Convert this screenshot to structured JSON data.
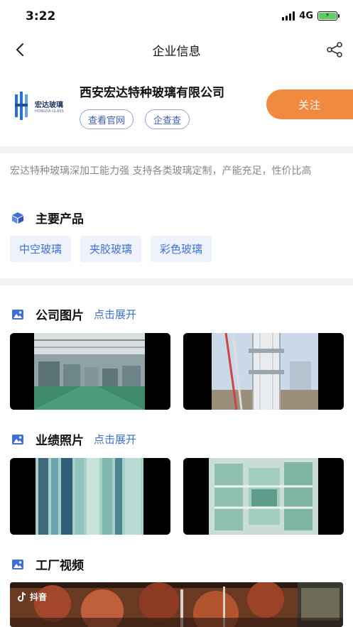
{
  "status_bar": {
    "time": "3:22",
    "network": "4G"
  },
  "nav": {
    "title": "企业信息"
  },
  "company": {
    "name": "西安宏达特种玻璃有限公司",
    "logo_cn": "宏达玻璃",
    "logo_en": "HONGDA GLASS",
    "website_label": "查看官网",
    "check_label": "企查查",
    "follow_label": "关注"
  },
  "description": "宏达特种玻璃深加工能力强 支持各类玻璃定制，产能充足，性价比高",
  "products": {
    "title": "主要产品",
    "items": [
      "中空玻璃",
      "夹胶玻璃",
      "彩色玻璃"
    ]
  },
  "company_photos": {
    "title": "公司图片",
    "expand": "点击展开"
  },
  "performance_photos": {
    "title": "业绩照片",
    "expand": "点击展开"
  },
  "factory_video": {
    "title": "工厂视频",
    "brand": "抖音"
  },
  "colors": {
    "accent": "#3e6fd1",
    "follow": "#f08a3e",
    "tag_bg": "#eef3fb"
  },
  "icons": [
    "back-icon",
    "share-icon",
    "cube-icon",
    "image-icon"
  ]
}
